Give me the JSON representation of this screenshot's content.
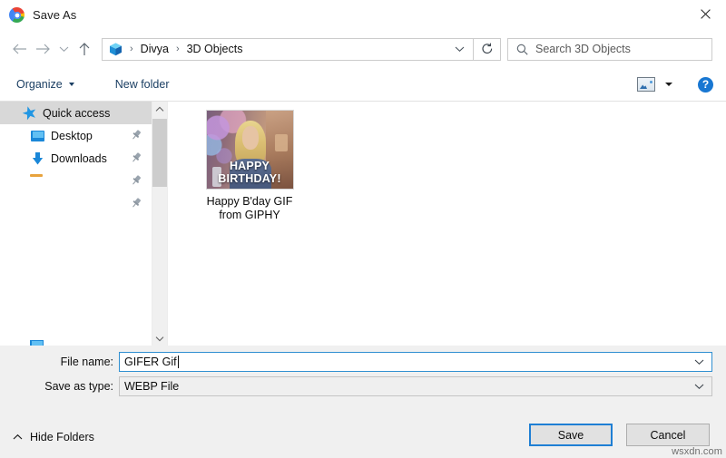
{
  "window": {
    "title": "Save As",
    "app_icon": "chrome-icon",
    "close_label": "✕"
  },
  "navigation": {
    "back_icon": "arrow-left-icon",
    "forward_icon": "arrow-right-icon",
    "recent_icon": "chevron-down-icon",
    "up_icon": "arrow-up-icon",
    "address": {
      "folder_icon": "3d-objects-cube-icon",
      "crumbs": [
        "Divya",
        "3D Objects"
      ],
      "separator": "›",
      "dropdown_icon": "chevron-down-icon"
    },
    "refresh_icon": "refresh-icon",
    "search": {
      "icon": "search-icon",
      "placeholder": "Search 3D Objects",
      "value": ""
    }
  },
  "toolbar": {
    "organize_label": "Organize",
    "new_folder_label": "New folder",
    "view_icon": "view-options-icon",
    "view_dropdown_icon": "chevron-down-icon",
    "help_icon": "help-icon",
    "help_label": "?"
  },
  "sidebar": {
    "items": [
      {
        "label": "Quick access",
        "icon": "star-icon",
        "selected": true,
        "pinned": false
      },
      {
        "label": "Desktop",
        "icon": "desktop-monitor-icon",
        "selected": false,
        "pinned": true
      },
      {
        "label": "Downloads",
        "icon": "download-arrow-icon",
        "selected": false,
        "pinned": true
      }
    ],
    "extra_pins": 2,
    "clipped_item": {
      "label": "",
      "icon": "this-pc-icon"
    },
    "scrollbar": {
      "up_icon": "chevron-up-icon",
      "down_icon": "chevron-down-icon"
    }
  },
  "file_list": {
    "items": [
      {
        "name": "Happy B'day GIF\nfrom GIPHY",
        "name_line1": "Happy B'day GIF",
        "name_line2": "from GIPHY",
        "thumbnail_caption_line1": "HAPPY",
        "thumbnail_caption_line2": "BIRTHDAY!",
        "selected": false
      }
    ]
  },
  "form": {
    "file_name_label": "File name:",
    "file_name_value": "GIFER Gif",
    "file_name_dropdown_icon": "chevron-down-icon",
    "save_as_type_label": "Save as type:",
    "save_as_type_value": "WEBP File",
    "save_as_type_dropdown_icon": "chevron-down-icon"
  },
  "footer": {
    "hide_folders_label": "Hide Folders",
    "hide_folders_icon": "chevron-up-icon",
    "save_label": "Save",
    "cancel_label": "Cancel"
  },
  "watermark": "wsxdn.com",
  "colors": {
    "accent_blue": "#1f7fd4",
    "link_blue": "#1b3f63",
    "selection_grey": "#d8d8d8",
    "dialog_grey": "#f0f0f0"
  }
}
